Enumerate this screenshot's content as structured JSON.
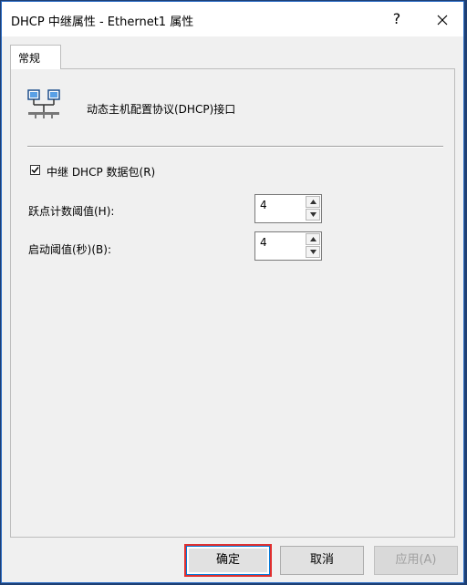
{
  "window": {
    "title": "DHCP 中继属性 - Ethernet1 属性",
    "help_label": "?",
    "close_label": "✕"
  },
  "tabs": [
    {
      "label": "常规",
      "active": true
    }
  ],
  "general": {
    "interface_label": "动态主机配置协议(DHCP)接口",
    "relay_checkbox": {
      "label": "中继 DHCP 数据包(R)",
      "checked": true
    },
    "hop_threshold": {
      "label": "跃点计数阈值(H):",
      "value": "4"
    },
    "boot_threshold": {
      "label": "启动阈值(秒)(B):",
      "value": "4"
    }
  },
  "buttons": {
    "ok": "确定",
    "cancel": "取消",
    "apply": "应用(A)",
    "apply_enabled": false
  },
  "colors": {
    "highlight": "#e03030",
    "focus": "#0078d7"
  }
}
